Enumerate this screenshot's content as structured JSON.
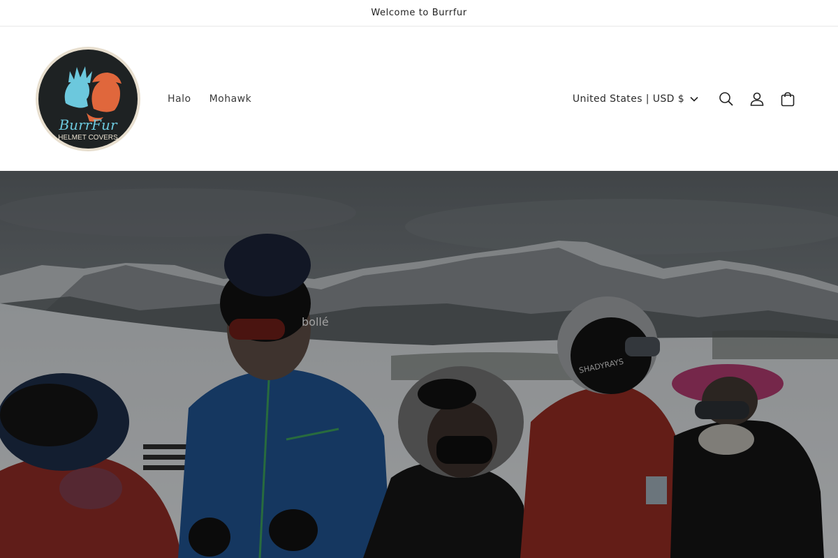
{
  "announcement": {
    "text": "Welcome to Burrfur"
  },
  "logo": {
    "text_line1": "BurrFur",
    "text_line2": "HELMET COVERS",
    "colors": {
      "teal": "#6cc8dd",
      "orange": "#e0673c",
      "dark": "#1e2223",
      "ring": "#e8dfcf"
    }
  },
  "nav": {
    "items": [
      {
        "label": "Halo"
      },
      {
        "label": "Mohawk"
      }
    ]
  },
  "header": {
    "localization": {
      "label": "United States | USD $",
      "icon": "chevron-down-icon"
    },
    "icons": {
      "search": "search-icon",
      "account": "user-icon",
      "cart": "bag-icon"
    }
  },
  "hero": {
    "overlay_opacity": 0.3,
    "brand_text_on_goggles": "bollé",
    "brand_text_on_helmet": "SHADYRAYS"
  }
}
